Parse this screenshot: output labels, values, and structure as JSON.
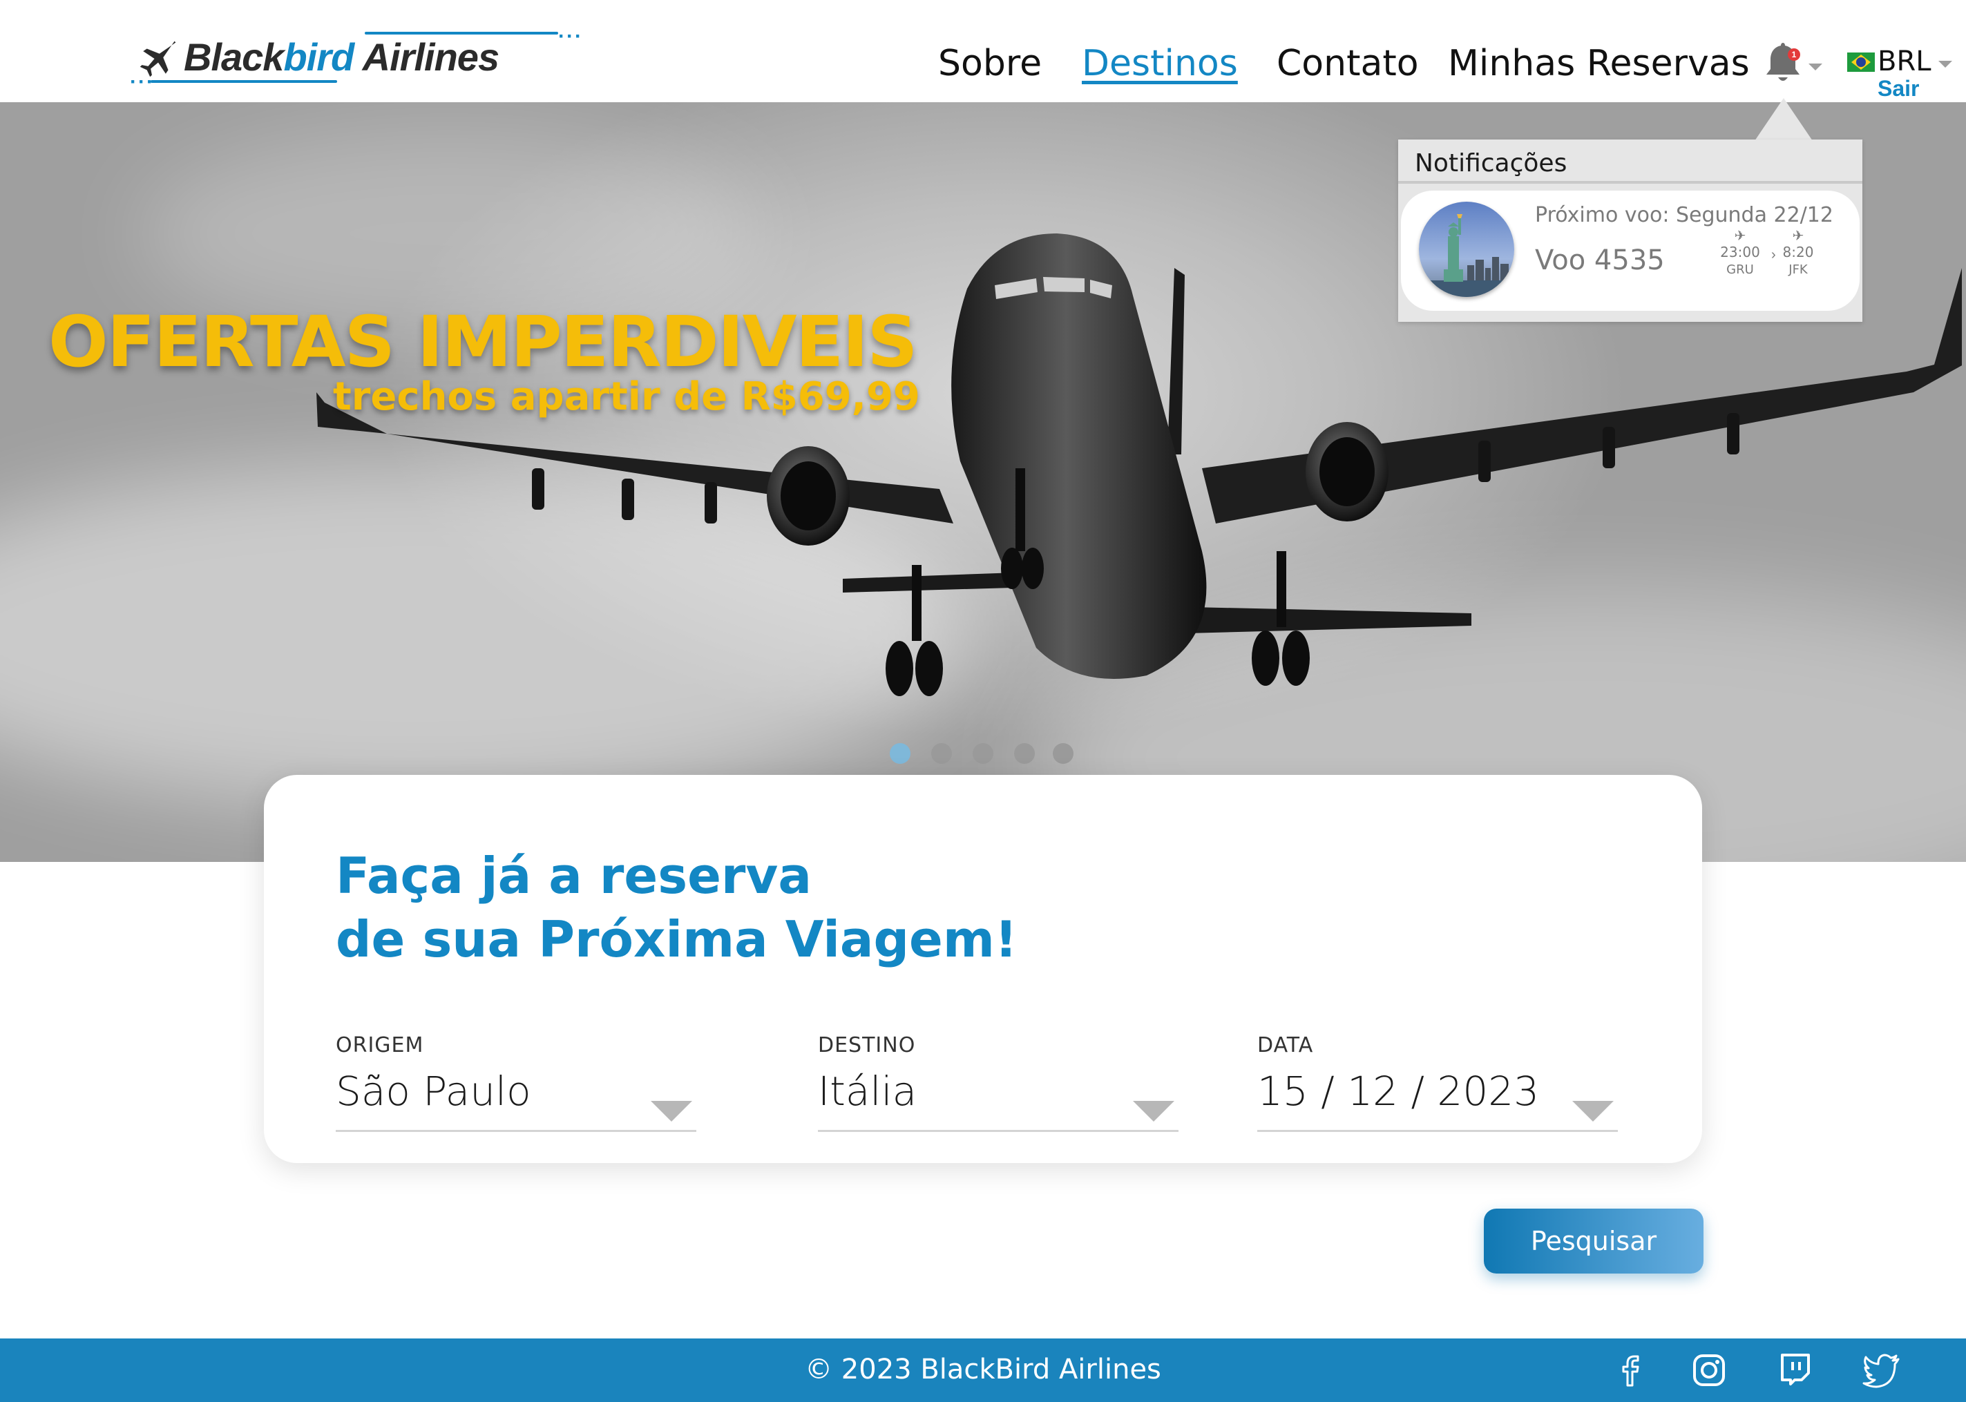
{
  "header": {
    "brand": {
      "part1": "Black",
      "part2": "bird",
      "part3": " Airlines"
    },
    "nav": [
      {
        "label": "Sobre",
        "active": false
      },
      {
        "label": "Destinos",
        "active": true
      },
      {
        "label": "Contato",
        "active": false
      },
      {
        "label": "Minhas Reservas",
        "active": false
      }
    ],
    "notification_count": "1",
    "currency": "BRL",
    "logout_label": "Sair"
  },
  "hero": {
    "title": "OFERTAS IMPERDIVEIS",
    "subtitle": "trechos apartir de R$69,99",
    "slides_total": 5,
    "active_slide": 1
  },
  "notifications": {
    "title": "Notificações",
    "items": [
      {
        "next_flight": "Próximo voo: Segunda 22/12",
        "flight": "Voo 4535",
        "departure_time": "23:00",
        "arrival_time": "8:20",
        "origin_code": "GRU",
        "destination_code": "JFK"
      }
    ]
  },
  "booking": {
    "headline_line1": "Faça já a reserva",
    "headline_line2": "de sua Próxima Viagem!",
    "fields": [
      {
        "label": "ORIGEM",
        "value": "São Paulo"
      },
      {
        "label": "DESTINO",
        "value": "Itália"
      },
      {
        "label": "DATA",
        "value": "15 / 12 / 2023"
      }
    ],
    "search_label": "Pesquisar"
  },
  "footer": {
    "copyright": "© 2023 BlackBird Airlines",
    "social": [
      "facebook-icon",
      "instagram-icon",
      "twitch-icon",
      "twitter-icon"
    ]
  },
  "colors": {
    "brand_blue": "#1387c4",
    "accent_yellow": "#f5bd09",
    "footer_blue": "#1a84bd",
    "badge_red": "#e33a3a"
  }
}
